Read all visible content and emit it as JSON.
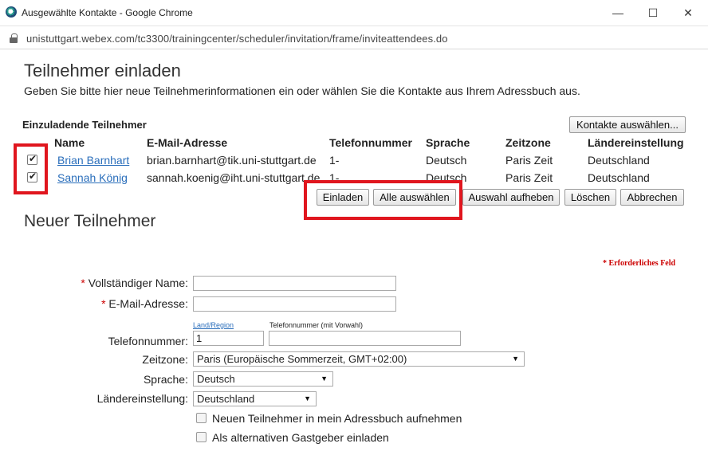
{
  "window": {
    "title": "Ausgewählte Kontakte - Google Chrome",
    "url": "unistuttgart.webex.com/tc3300/trainingcenter/scheduler/invitation/frame/inviteattendees.do",
    "minimize": "—",
    "maximize": "☐",
    "close": "✕"
  },
  "page": {
    "title": "Teilnehmer einladen",
    "intro": "Geben Sie bitte hier neue Teilnehmerinformationen ein oder wählen Sie die Kontakte aus Ihrem Adressbuch aus.",
    "section_label": "Einzuladende Teilnehmer",
    "select_contacts_button": "Kontakte auswählen...",
    "columns": [
      "Name",
      "E-Mail-Adresse",
      "Telefonnummer",
      "Sprache",
      "Zeitzone",
      "Ländereinstellung"
    ],
    "rows": [
      {
        "checked": true,
        "name": "Brian Barnhart",
        "email": "brian.barnhart@tik.uni-stuttgart.de",
        "phone": "1-",
        "language": "Deutsch",
        "timezone": "Paris Zeit",
        "locale": "Deutschland"
      },
      {
        "checked": true,
        "name": "Sannah König",
        "email": "sannah.koenig@iht.uni-stuttgart.de",
        "phone": "1-",
        "language": "Deutsch",
        "timezone": "Paris Zeit",
        "locale": "Deutschland"
      }
    ],
    "actions": {
      "invite": "Einladen",
      "select_all": "Alle auswählen",
      "deselect": "Auswahl aufheben",
      "delete": "Löschen",
      "cancel": "Abbrechen"
    },
    "highlight_color": "#e0161e"
  },
  "new_participant": {
    "title": "Neuer Teilnehmer",
    "required_note": "* Erforderliches Feld",
    "full_name_label": "Vollständiger Name:",
    "full_name_value": "",
    "email_label": "E-Mail-Adresse:",
    "email_value": "",
    "country_region_link": "Land/Region",
    "phone_hint": "Telefonnummer (mit Vorwahl)",
    "phone_label": "Telefonnummer:",
    "phone_country_code": "1",
    "phone_number": "",
    "timezone_label": "Zeitzone:",
    "timezone_value": "Paris (Europäische Sommerzeit, GMT+02:00)",
    "language_label": "Sprache:",
    "language_value": "Deutsch",
    "locale_label": "Ländereinstellung:",
    "locale_value": "Deutschland",
    "add_to_addressbook": "Neuen Teilnehmer in mein Adressbuch aufnehmen",
    "invite_as_alt_host": "Als alternativen Gastgeber einladen",
    "required_star": "*"
  }
}
